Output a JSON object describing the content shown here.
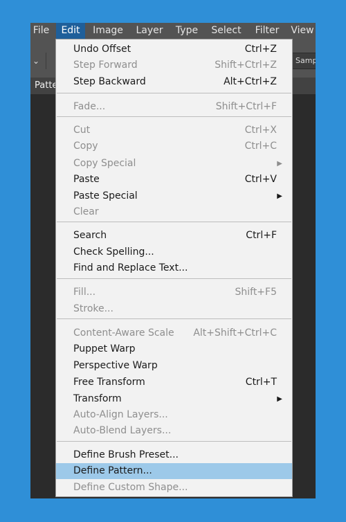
{
  "menubar": [
    "File",
    "Edit",
    "Image",
    "Layer",
    "Type",
    "Select",
    "Filter",
    "View"
  ],
  "optionsbar": {
    "sample_text": "Samp"
  },
  "panel": {
    "tab_label": "Patte"
  },
  "menu_items": [
    {
      "label": "Undo Offset",
      "shortcut": "Ctrl+Z",
      "enabled": true
    },
    {
      "label": "Step Forward",
      "shortcut": "Shift+Ctrl+Z",
      "enabled": false
    },
    {
      "label": "Step Backward",
      "shortcut": "Alt+Ctrl+Z",
      "enabled": true
    },
    {
      "label": "Fade...",
      "shortcut": "Shift+Ctrl+F",
      "enabled": false
    },
    {
      "label": "Cut",
      "shortcut": "Ctrl+X",
      "enabled": false
    },
    {
      "label": "Copy",
      "shortcut": "Ctrl+C",
      "enabled": false
    },
    {
      "label": "Copy Special",
      "shortcut": "",
      "enabled": false,
      "submenu": true
    },
    {
      "label": "Paste",
      "shortcut": "Ctrl+V",
      "enabled": true
    },
    {
      "label": "Paste Special",
      "shortcut": "",
      "enabled": true,
      "submenu": true
    },
    {
      "label": "Clear",
      "shortcut": "",
      "enabled": false
    },
    {
      "label": "Search",
      "shortcut": "Ctrl+F",
      "enabled": true
    },
    {
      "label": "Check Spelling...",
      "shortcut": "",
      "enabled": true
    },
    {
      "label": "Find and Replace Text...",
      "shortcut": "",
      "enabled": true
    },
    {
      "label": "Fill...",
      "shortcut": "Shift+F5",
      "enabled": false
    },
    {
      "label": "Stroke...",
      "shortcut": "",
      "enabled": false
    },
    {
      "label": "Content-Aware Scale",
      "shortcut": "Alt+Shift+Ctrl+C",
      "enabled": false
    },
    {
      "label": "Puppet Warp",
      "shortcut": "",
      "enabled": true
    },
    {
      "label": "Perspective Warp",
      "shortcut": "",
      "enabled": true
    },
    {
      "label": "Free Transform",
      "shortcut": "Ctrl+T",
      "enabled": true
    },
    {
      "label": "Transform",
      "shortcut": "",
      "enabled": true,
      "submenu": true
    },
    {
      "label": "Auto-Align Layers...",
      "shortcut": "",
      "enabled": false
    },
    {
      "label": "Auto-Blend Layers...",
      "shortcut": "",
      "enabled": false
    },
    {
      "label": "Define Brush Preset...",
      "shortcut": "",
      "enabled": true
    },
    {
      "label": "Define Pattern...",
      "shortcut": "",
      "enabled": true,
      "highlighted": true
    },
    {
      "label": "Define Custom Shape...",
      "shortcut": "",
      "enabled": false
    }
  ],
  "icons": {
    "submenu_arrow": "submenu-arrow-icon",
    "dropdown_chevron": "chevron-down-icon"
  },
  "colors": {
    "background": "#2f8fd7",
    "menubar": "#535353",
    "active_menu": "#1f5f9a",
    "menu_bg": "#f2f2f2",
    "highlight": "#9dc9e9",
    "disabled_text": "#8e8e8e"
  }
}
